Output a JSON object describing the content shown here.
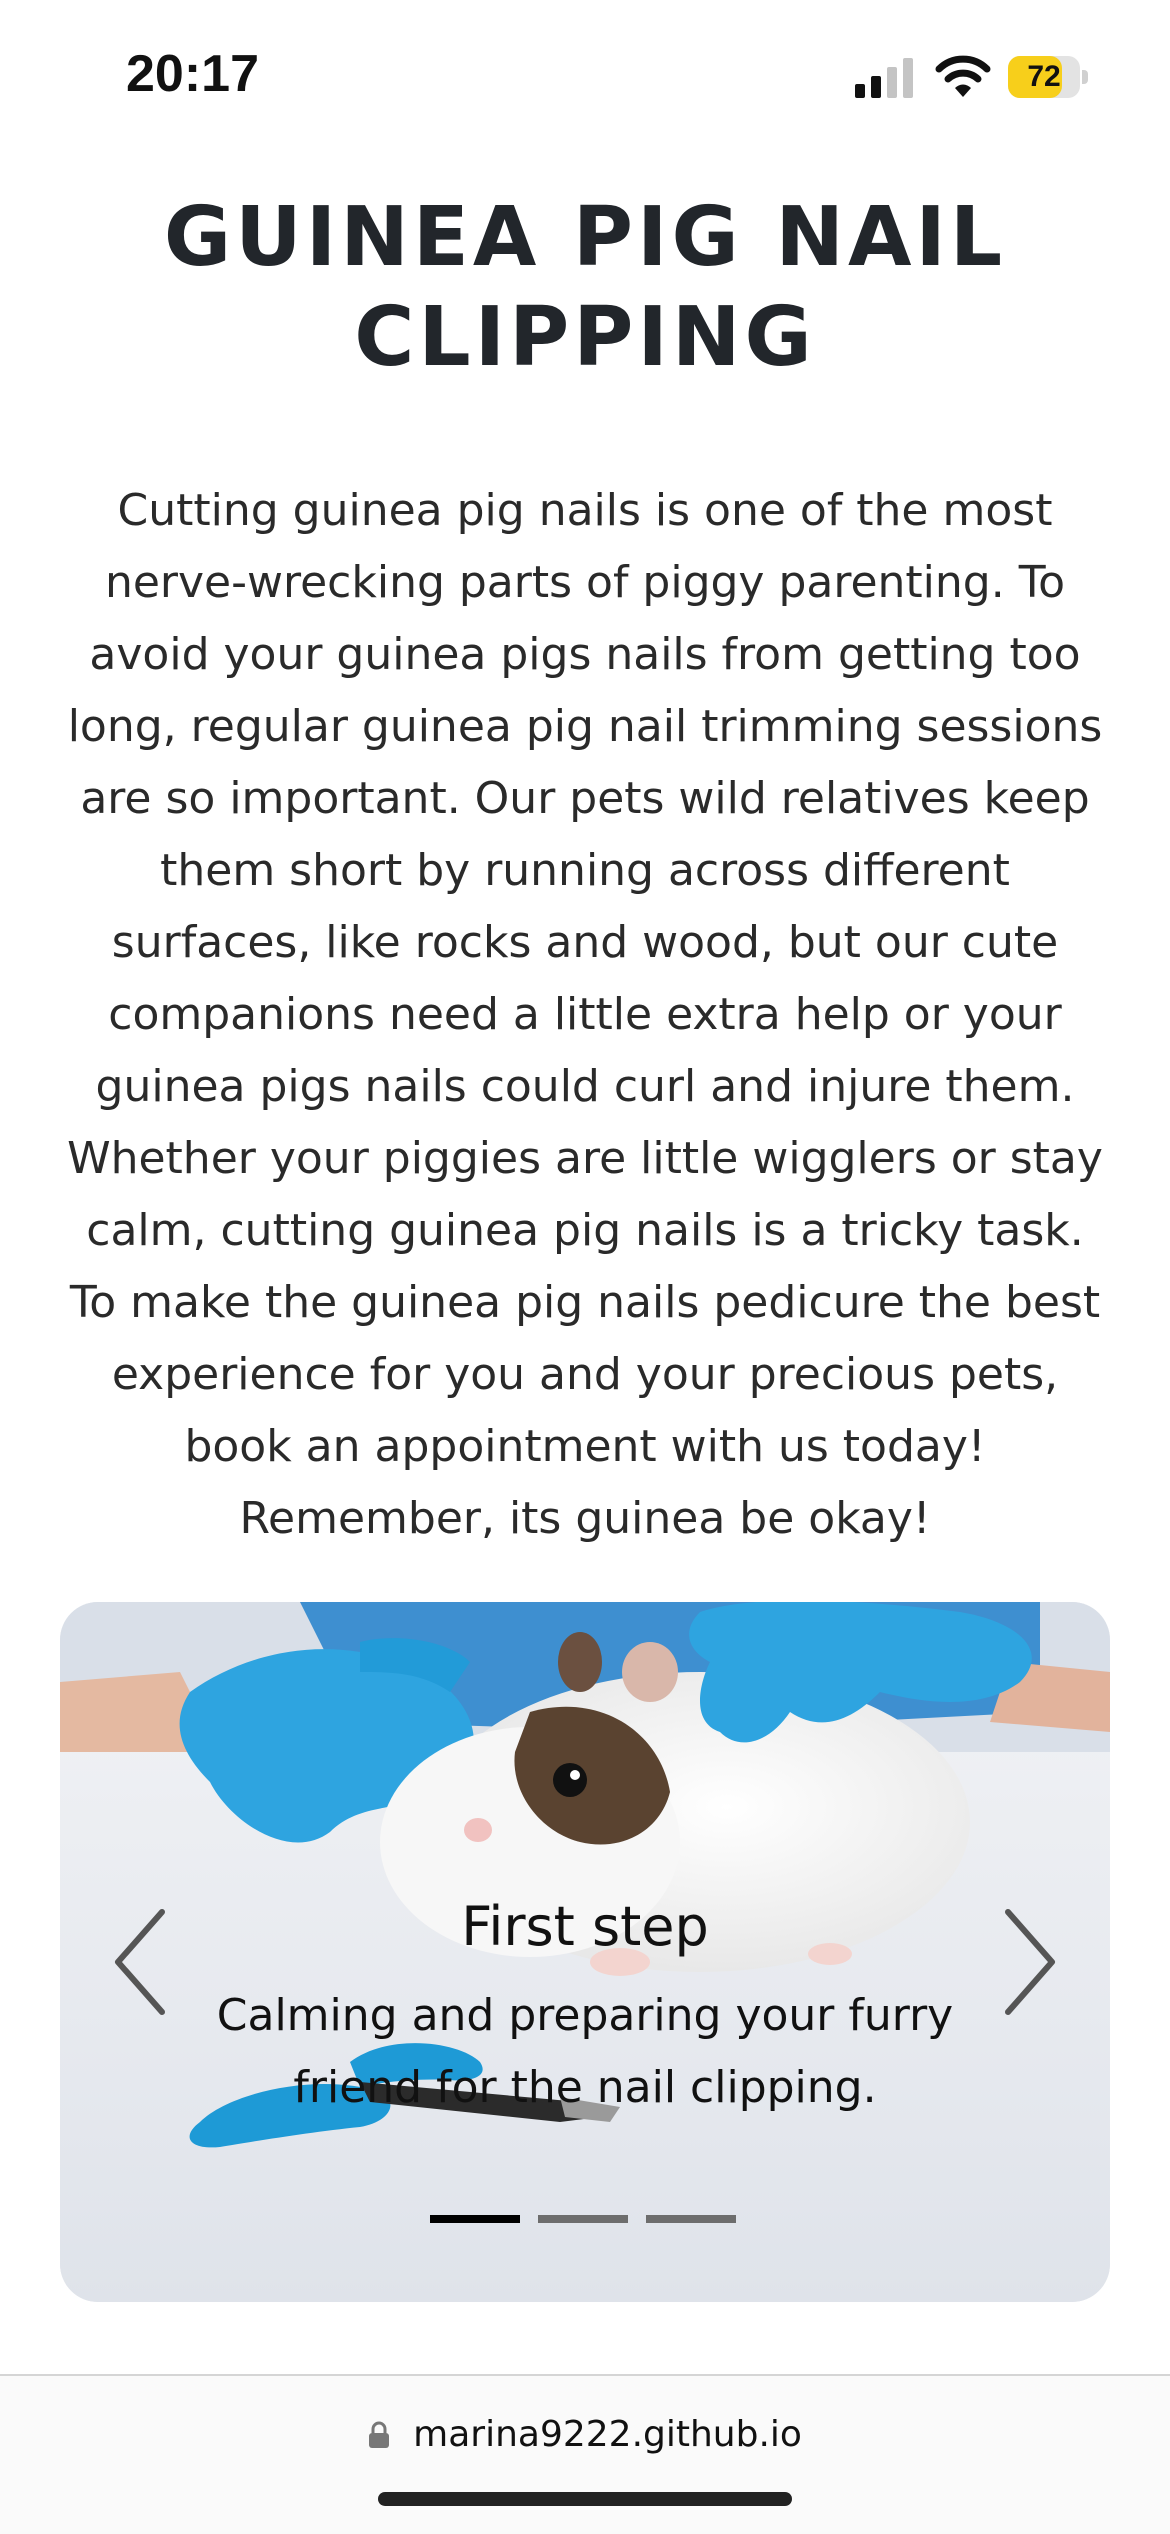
{
  "status_bar": {
    "time": "20:17",
    "battery_level": "72",
    "battery_color": "#f7cf1b"
  },
  "page": {
    "title": "GUINEA PIG NAIL CLIPPING",
    "intro": "Cutting guinea pig nails is one of the most nerve-wrecking parts of piggy parenting. To avoid your guinea pigs nails from getting too long, regular guinea pig nail trimming sessions are so important. Our pets wild relatives keep them short by running across different surfaces, like rocks and wood, but our cute companions need a little extra help or your guinea pigs nails could curl and injure them. Whether your piggies are little wigglers or stay calm, cutting guinea pig nails is a tricky task. To make the guinea pig nails pedicure the best experience for you and your precious pets, book an appointment with us today! Remember, its guinea be okay!"
  },
  "carousel": {
    "slide_title": "First step",
    "slide_text": "Calming and preparing your furry friend for the nail clipping.",
    "prev_icon": "chevron-left-icon",
    "next_icon": "chevron-right-icon",
    "active_slide": 1,
    "slide_count": 3
  },
  "browser": {
    "url": "marina9222.github.io",
    "lock_icon": "lock-icon"
  }
}
